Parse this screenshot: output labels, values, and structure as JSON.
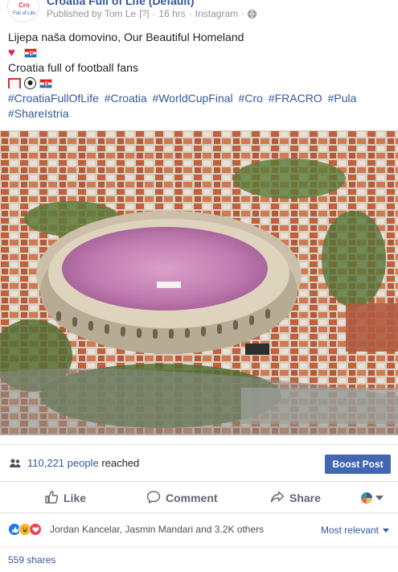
{
  "post": {
    "page_name": "Croatia Full of Life (Default)",
    "published_by": "Published by Tom Le",
    "help_mark": "[?]",
    "dot1": "·",
    "time": "16 hrs",
    "dot2": "·",
    "source": "Instagram",
    "dot3": "·",
    "line1": "Lijepa naša domovino, Our Beautiful Homeland",
    "line3": "Croatia full of football fans",
    "hashtags": [
      "#CroatiaFullOfLife",
      "#Croatia",
      "#WorldCupFinal",
      "#Cro",
      "#FRACRO",
      "#Pula",
      "#ShareIstria"
    ],
    "emoji_line_a": [
      "heart",
      "croatian-flag"
    ],
    "emoji_line_b": [
      "goal",
      "soccer-ball",
      "croatian-flag"
    ]
  },
  "reach": {
    "count": "110,221 people",
    "suffix": "reached",
    "boost_label": "Boost Post"
  },
  "actions": {
    "like": "Like",
    "comment": "Comment",
    "share": "Share"
  },
  "reactions": {
    "names": "Jordan Kancelar, Jasmin Mandari and 3.2K others",
    "sort": "Most relevant"
  },
  "shares": {
    "label": "559 shares"
  },
  "colors": {
    "link": "#365899",
    "boost": "#4267b2",
    "text": "#1d2129",
    "muted": "#90949c"
  }
}
